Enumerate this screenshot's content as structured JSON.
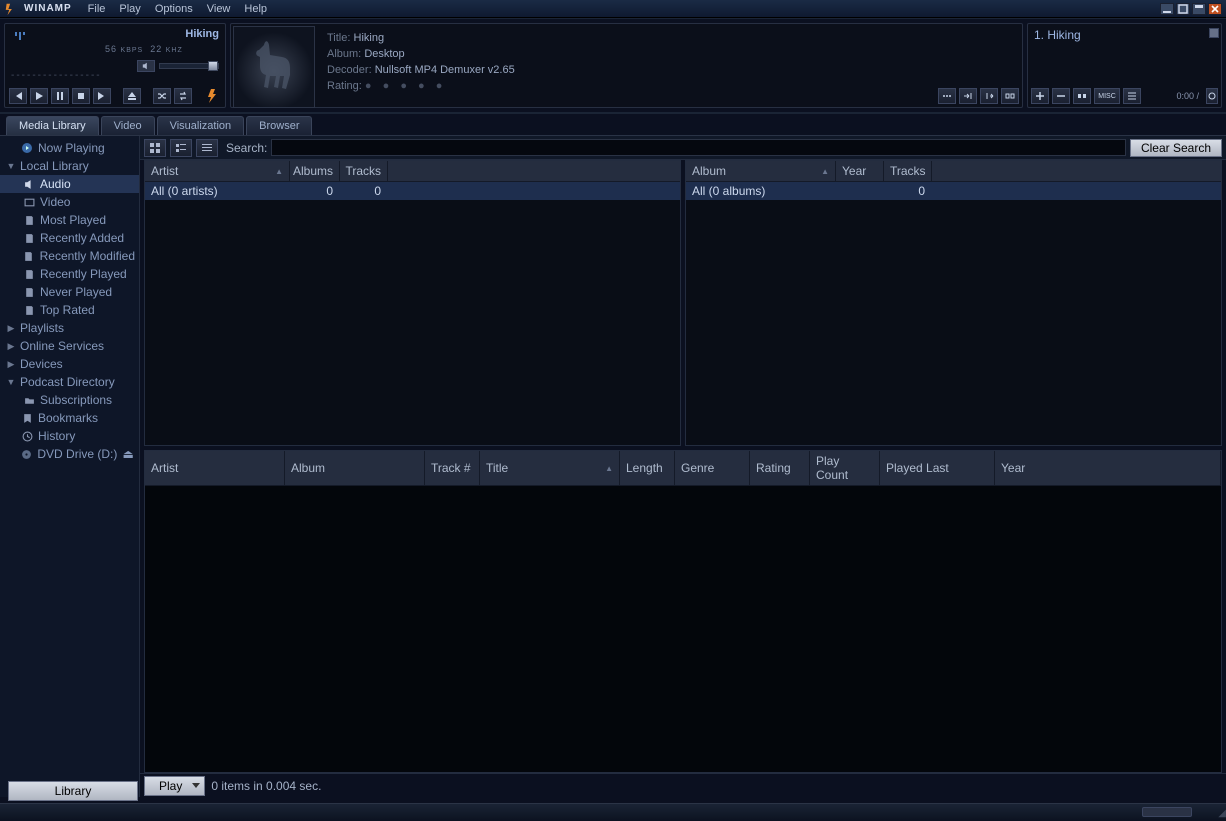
{
  "app_name": "WINAMP",
  "menu": {
    "file": "File",
    "play": "Play",
    "options": "Options",
    "view": "View",
    "help": "Help"
  },
  "player": {
    "track": "Hiking",
    "bitrate": "56",
    "bitrate_unit": "KBPS",
    "freq": "22",
    "freq_unit": "KHZ"
  },
  "nowinfo": {
    "title_lbl": "Title:",
    "title_val": "Hiking",
    "album_lbl": "Album:",
    "album_val": "Desktop",
    "decoder_lbl": "Decoder:",
    "decoder_val": "Nullsoft MP4 Demuxer v2.65",
    "rating_lbl": "Rating:"
  },
  "playlist": {
    "item1": "1. Hiking",
    "time": "0:00 /"
  },
  "tabs": {
    "media": "Media Library",
    "video": "Video",
    "vis": "Visualization",
    "browser": "Browser"
  },
  "sidebar": {
    "now_playing": "Now Playing",
    "local": "Local Library",
    "audio": "Audio",
    "video": "Video",
    "most_played": "Most Played",
    "recently_added": "Recently Added",
    "recently_modified": "Recently Modified",
    "recently_played": "Recently Played",
    "never_played": "Never Played",
    "top_rated": "Top Rated",
    "playlists": "Playlists",
    "online": "Online Services",
    "devices": "Devices",
    "podcast": "Podcast Directory",
    "subs": "Subscriptions",
    "bookmarks": "Bookmarks",
    "history": "History",
    "dvd": "DVD Drive (D:)"
  },
  "search": {
    "label": "Search:",
    "clear": "Clear Search"
  },
  "artist_cols": {
    "artist": "Artist",
    "albums": "Albums",
    "tracks": "Tracks"
  },
  "artist_row": {
    "name": "All (0 artists)",
    "albums": "0",
    "tracks": "0"
  },
  "album_cols": {
    "album": "Album",
    "year": "Year",
    "tracks": "Tracks"
  },
  "album_row": {
    "name": "All (0 albums)",
    "year": "",
    "tracks": "0"
  },
  "track_cols": {
    "artist": "Artist",
    "album": "Album",
    "trackno": "Track #",
    "title": "Title",
    "length": "Length",
    "genre": "Genre",
    "rating": "Rating",
    "playcount": "Play Count",
    "played_last": "Played Last",
    "year": "Year"
  },
  "footer": {
    "play": "Play",
    "status": "0 items in 0.004 sec.",
    "library": "Library"
  },
  "pl_btn": {
    "misc": "MISC"
  }
}
